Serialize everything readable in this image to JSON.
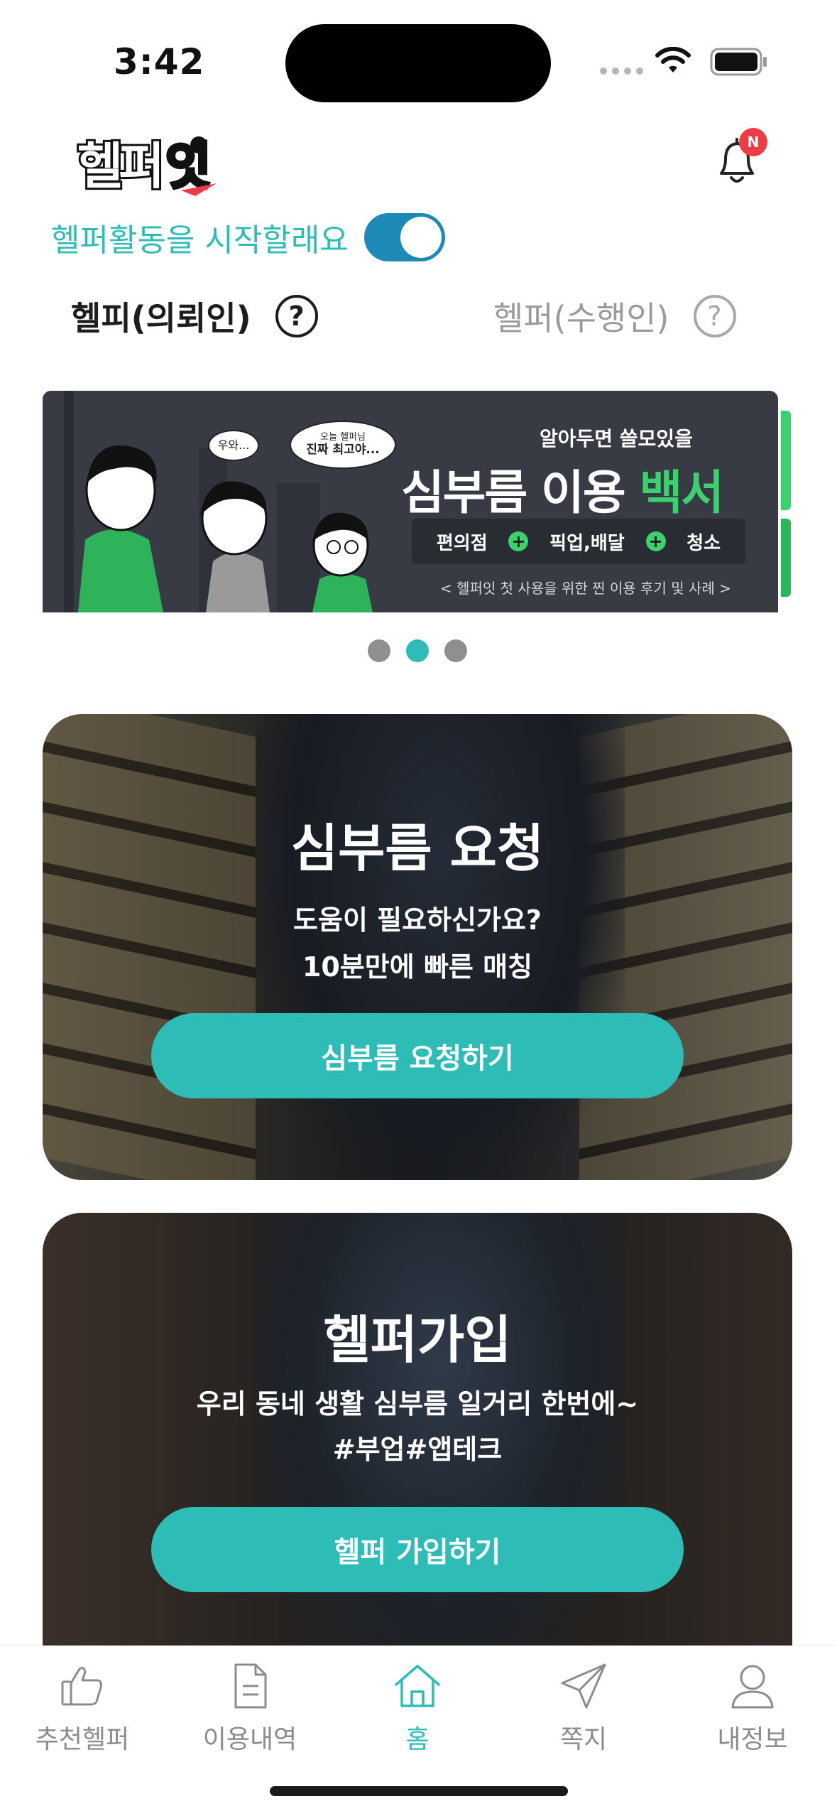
{
  "status_bar": {
    "time": "3:42"
  },
  "header": {
    "logo_text": "헬퍼잇",
    "notification_badge": "N"
  },
  "toggle": {
    "label": "헬퍼활동을 시작할래요",
    "state": "on"
  },
  "roles": {
    "left": {
      "label": "헬피(의뢰인)",
      "help": "?"
    },
    "right": {
      "label": "헬퍼(수행인)",
      "help": "?"
    }
  },
  "banner": {
    "bubble1": "우와...",
    "bubble2_line1": "오늘 헬퍼님",
    "bubble2_line2": "진짜 최고야...",
    "subtitle": "알아두면 쓸모있을",
    "title_main": "심부름 이용 ",
    "title_accent": "백서",
    "pill_items": [
      "편의점",
      "픽업,배달",
      "청소"
    ],
    "footnote": "< 헬퍼잇 첫 사용을 위한 찐 이용 후기 및 사례 >",
    "page_index": 2,
    "page_count": 3
  },
  "card_request": {
    "title": "심부름 요청",
    "desc_line1": "도움이 필요하신가요?",
    "desc_line2": "10분만에 빠른 매칭",
    "button": "심부름 요청하기"
  },
  "card_helper": {
    "title": "헬퍼가입",
    "desc_line1": "우리 동네 생활 심부름 일거리 한번에~",
    "desc_line2": "#부업#앱테크",
    "button": "헬퍼 가입하기"
  },
  "tabs": [
    {
      "label": "추천헬퍼",
      "icon": "thumbs-up-icon"
    },
    {
      "label": "이용내역",
      "icon": "document-icon"
    },
    {
      "label": "홈",
      "icon": "home-icon",
      "active": true
    },
    {
      "label": "쪽지",
      "icon": "paper-plane-icon"
    },
    {
      "label": "내정보",
      "icon": "person-icon"
    }
  ],
  "colors": {
    "accent": "#2dbdb6",
    "toggle": "#1e88b7",
    "badge": "#ef3b45",
    "banner_green": "#3bd16f"
  }
}
